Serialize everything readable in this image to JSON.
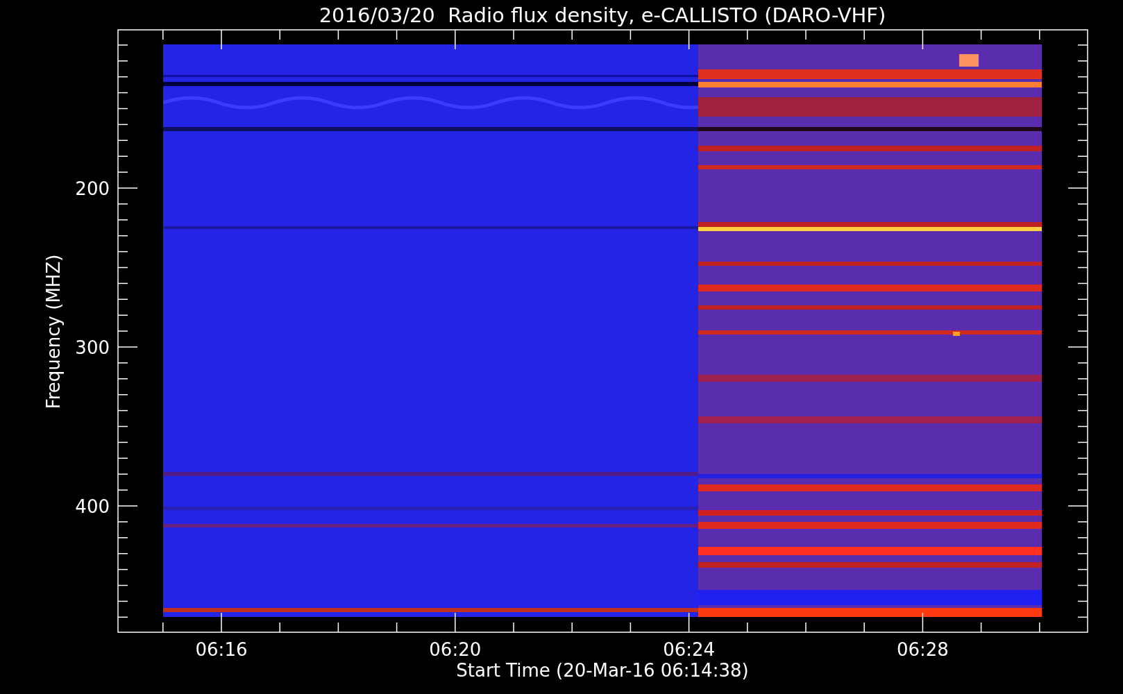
{
  "chart": {
    "title": "2016/03/20  Radio flux density, e-CALLISTO (DARO-VHF)",
    "ylabel": "Frequency (MHZ)",
    "xlabel": "Start Time (20-Mar-16 06:14:38)",
    "y_tick_labels": [
      "200",
      "300",
      "400"
    ],
    "x_tick_labels": [
      "06:16",
      "06:20",
      "06:24",
      "06:28"
    ]
  }
}
